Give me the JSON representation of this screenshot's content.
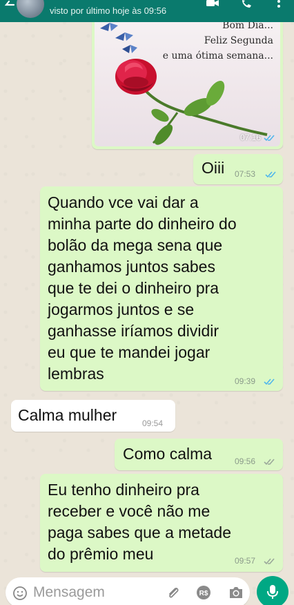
{
  "header": {
    "last_seen": "visto por último hoje às 09:56",
    "accent_color": "#0a7a6d",
    "icons": [
      "back-arrow-icon",
      "video-call-icon",
      "phone-icon",
      "more-vertical-icon"
    ]
  },
  "image_message": {
    "caption_lines": [
      "Bom Dia...",
      "Feliz Segunda",
      "e uma ótima semana..."
    ],
    "time": "07:16",
    "status": "read"
  },
  "messages": [
    {
      "direction": "out",
      "lines": [
        "Oiii"
      ],
      "time": "07:53",
      "status": "read"
    },
    {
      "direction": "out",
      "lines": [
        "Quando vce vai dar a",
        "minha parte do dinheiro do",
        "bolão da mega sena que",
        "ganhamos juntos sabes",
        "que te dei o dinheiro pra",
        "jogarmos juntos e se",
        "ganhasse iríamos dividir",
        "eu que te mandei jogar",
        "lembras"
      ],
      "time": "09:39",
      "status": "read"
    },
    {
      "direction": "in",
      "lines": [
        "Calma mulher"
      ],
      "time": "09:54"
    },
    {
      "direction": "out",
      "lines": [
        "Como calma"
      ],
      "time": "09:56",
      "status": "delivered"
    },
    {
      "direction": "out",
      "lines": [
        "Eu tenho dinheiro pra",
        "receber e você não me",
        "paga sabes que a metade",
        "do prêmio meu"
      ],
      "time": "09:57",
      "status": "delivered"
    }
  ],
  "composer": {
    "placeholder": "Mensagem",
    "payment_label": "R$",
    "icons": [
      "emoji-icon",
      "attach-icon",
      "payment-icon",
      "camera-icon",
      "mic-icon"
    ]
  },
  "colors": {
    "outgoing_bubble": "#dcf8c6",
    "incoming_bubble": "#ffffff",
    "read_check": "#4fb6ec",
    "delivered_check": "#9aa79a"
  }
}
